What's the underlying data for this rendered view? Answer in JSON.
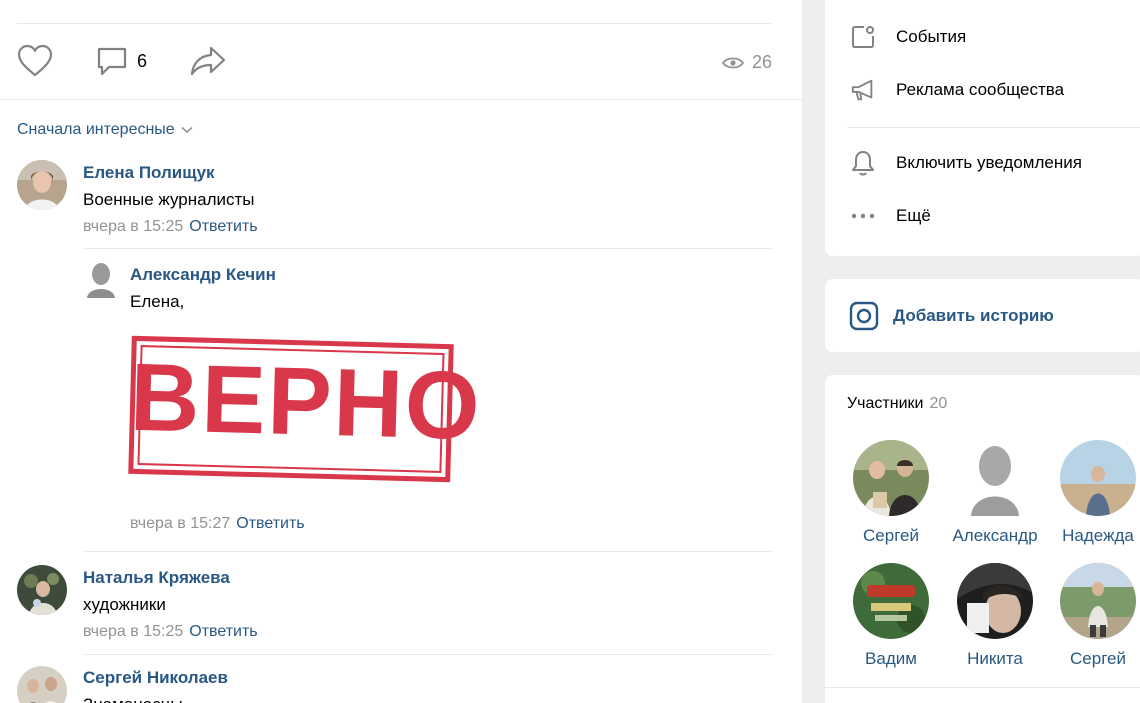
{
  "post": {
    "comments_count": "6",
    "views_count": "26"
  },
  "sort": {
    "label": "Сначала интересные"
  },
  "comments": [
    {
      "author": "Елена Полищук",
      "text": "Военные журналисты",
      "time": "вчера в 15:25",
      "reply": "Ответить"
    },
    {
      "author": "Александр Кечин",
      "text": "Елена,",
      "stamp": "ВЕРНО",
      "time": "вчера в 15:27",
      "reply": "Ответить"
    },
    {
      "author": "Наталья Кряжева",
      "text": "художники",
      "time": "вчера в 15:25",
      "reply": "Ответить"
    },
    {
      "author": "Сергей Николаев",
      "text": "Знаменосцы"
    }
  ],
  "sidebar": {
    "events": "События",
    "ads": "Реклама сообщества",
    "notifications": "Включить уведомления",
    "more": "Ещё",
    "add_story": "Добавить историю"
  },
  "members": {
    "title": "Участники",
    "count": "20",
    "list": [
      {
        "name": "Сергей"
      },
      {
        "name": "Александр"
      },
      {
        "name": "Надежда"
      },
      {
        "name": "Вадим"
      },
      {
        "name": "Никита"
      },
      {
        "name": "Сергей"
      }
    ]
  },
  "colors": {
    "link": "#2a5885",
    "stamp": "#d8384a",
    "muted": "#939393"
  }
}
